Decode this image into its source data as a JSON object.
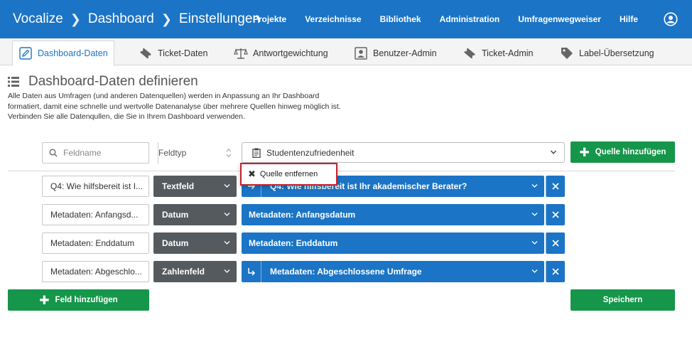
{
  "breadcrumb": [
    "Vocalize",
    "Dashboard",
    "Einstellungen"
  ],
  "topnav": [
    "Projekte",
    "Verzeichnisse",
    "Bibliothek",
    "Administration",
    "Umfragenwegweiser",
    "Hilfe"
  ],
  "tabs": [
    {
      "label": "Dashboard-Daten",
      "icon": "pencil-icon"
    },
    {
      "label": "Ticket-Daten",
      "icon": "ticket-icon"
    },
    {
      "label": "Antwortgewichtung",
      "icon": "scales-icon"
    },
    {
      "label": "Benutzer-Admin",
      "icon": "user-card-icon"
    },
    {
      "label": "Ticket-Admin",
      "icon": "ticket-icon"
    },
    {
      "label": "Label-Übersetzung",
      "icon": "tag-icon"
    }
  ],
  "header": {
    "title": "Dashboard-Daten definieren",
    "description_lines": [
      "Alle Daten aus Umfragen (und anderen Datenquellen) werden in Anpassung an Ihr Dashboard",
      "formatiert, damit eine schnelle und wertvolle Datenanalyse über mehrere Quellen hinweg möglich ist.",
      "Verbinden Sie alle Datenqullen, die Sie in Ihrem Dashboard verwenden."
    ]
  },
  "controls": {
    "search_placeholder": "Feldname",
    "field_type_label": "Feldtyp",
    "source_value": "Studentenzufriedenheit",
    "add_source_label": "Quelle hinzufügen"
  },
  "popup": {
    "label": "Quelle entfernen"
  },
  "rows": [
    {
      "label": "Q4: Wie hilfsbereit ist I...",
      "type": "Textfeld",
      "field": "Q4: Wie hilfsbereit ist Ihr akademischer Berater?"
    },
    {
      "label": "Metadaten: Anfangsd...",
      "type": "Datum",
      "field": "Metadaten: Anfangsdatum"
    },
    {
      "label": "Metadaten: Enddatum",
      "type": "Datum",
      "field": "Metadaten: Enddatum"
    },
    {
      "label": "Metadaten: Abgeschlo...",
      "type": "Zahlenfeld",
      "field": "Metadaten: Abgeschlossene Umfrage"
    }
  ],
  "footer": {
    "add_field_label": "Feld hinzufügen",
    "save_label": "Speichern"
  },
  "colors": {
    "brand_blue": "#1b74c5",
    "green": "#15964a",
    "dark_gray": "#555a5e",
    "highlight_red": "#c0242f"
  }
}
